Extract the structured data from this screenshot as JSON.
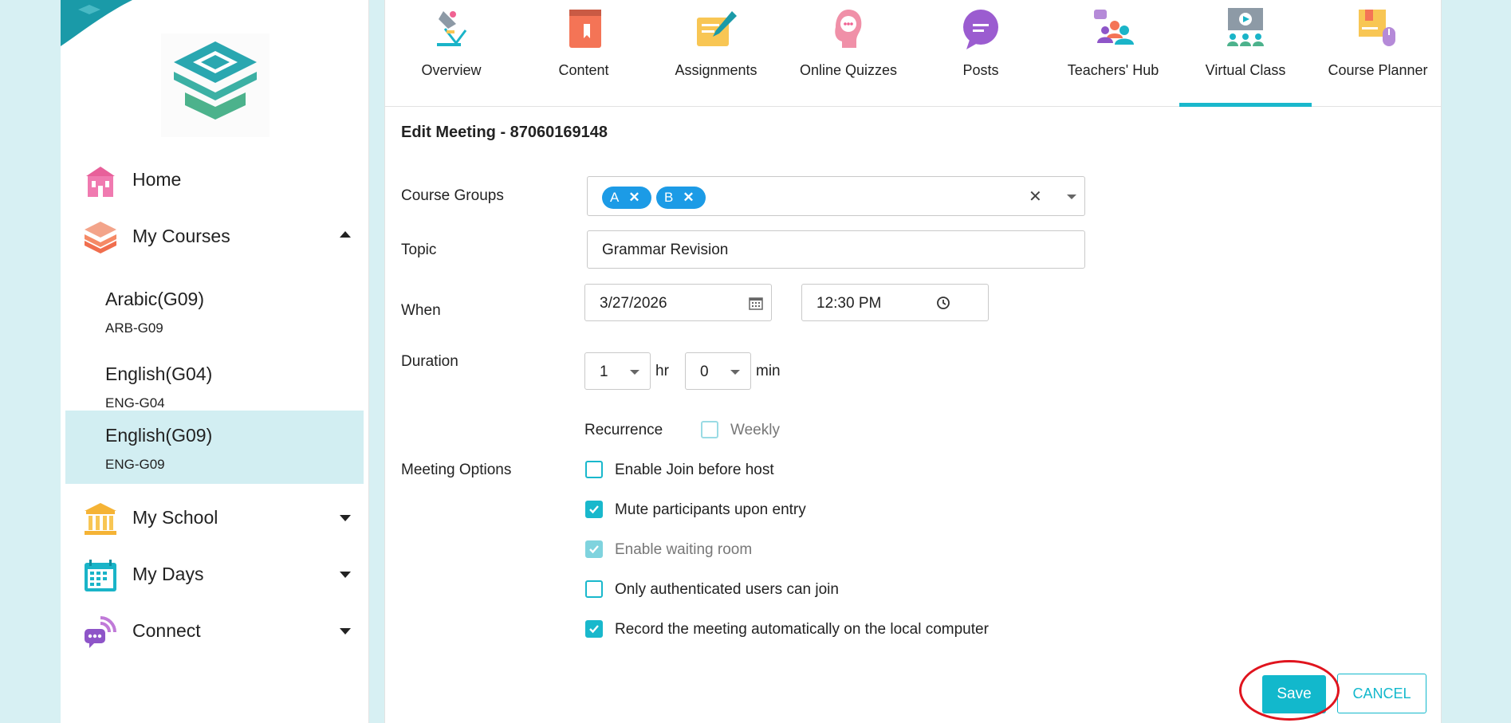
{
  "sidebar": {
    "nav": [
      {
        "label": "Home",
        "icon": "home-icon"
      },
      {
        "label": "My Courses",
        "icon": "courses-icon"
      },
      {
        "label": "My School",
        "icon": "school-icon"
      },
      {
        "label": "My Days",
        "icon": "calendar-icon"
      },
      {
        "label": "Connect",
        "icon": "connect-icon"
      }
    ],
    "courses": [
      {
        "name": "Arabic(G09)",
        "code": "ARB-G09"
      },
      {
        "name": "English(G04)",
        "code": "ENG-G04"
      },
      {
        "name": "English(G09)",
        "code": "ENG-G09",
        "active": true
      }
    ]
  },
  "tabs": [
    {
      "label": "Overview"
    },
    {
      "label": "Content"
    },
    {
      "label": "Assignments"
    },
    {
      "label": "Online Quizzes"
    },
    {
      "label": "Posts"
    },
    {
      "label": "Teachers' Hub"
    },
    {
      "label": "Virtual Class",
      "active": true
    },
    {
      "label": "Course Planner"
    }
  ],
  "form": {
    "title": "Edit Meeting - 87060169148",
    "course_groups": {
      "label": "Course Groups",
      "chips": [
        "A",
        "B"
      ]
    },
    "topic": {
      "label": "Topic",
      "value": "Grammar Revision"
    },
    "when": {
      "label": "When",
      "date": "3/27/2026",
      "time": "12:30 PM"
    },
    "duration": {
      "label": "Duration",
      "hours": "1",
      "hours_unit": "hr",
      "minutes": "0",
      "minutes_unit": "min"
    },
    "recurrence": {
      "label": "Recurrence",
      "option": "Weekly",
      "checked": false
    },
    "meeting_options": {
      "label": "Meeting Options",
      "options": [
        {
          "label": "Enable Join before host",
          "checked": false,
          "disabled": false
        },
        {
          "label": "Mute participants upon entry",
          "checked": true,
          "disabled": false
        },
        {
          "label": "Enable waiting room",
          "checked": true,
          "disabled": true
        },
        {
          "label": "Only authenticated users can join",
          "checked": false,
          "disabled": false
        },
        {
          "label": "Record the meeting automatically on the local computer",
          "checked": true,
          "disabled": false
        }
      ]
    },
    "save_label": "Save",
    "cancel_label": "CANCEL"
  },
  "colors": {
    "accent": "#12b8cc",
    "chip": "#1c9be6",
    "highlight_ring": "#e0141e",
    "page_bg": "#d7f0f3"
  }
}
